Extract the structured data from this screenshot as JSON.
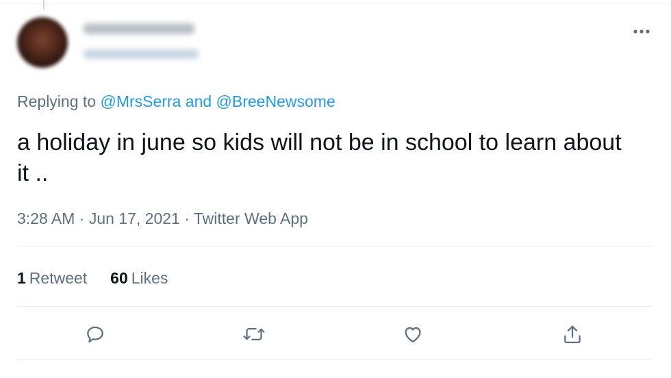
{
  "tweet": {
    "replying_prefix": "Replying to",
    "mentions": [
      "@MrsSerra",
      "@BreeNewsome"
    ],
    "mention_joiner": "and",
    "text": "a holiday in june so kids will not be in school to learn about it ..",
    "time": "3:28 AM",
    "date": "Jun 17, 2021",
    "source": "Twitter Web App",
    "separator": "·"
  },
  "stats": {
    "retweets_count": "1",
    "retweets_label": "Retweet",
    "likes_count": "60",
    "likes_label": "Likes"
  },
  "icons": {
    "more": "more-horizontal-icon",
    "reply": "reply-icon",
    "retweet": "retweet-icon",
    "like": "heart-icon",
    "share": "share-icon"
  },
  "colors": {
    "mention": "#1d9bf0",
    "secondary_text": "#5b7083",
    "primary_text": "#0f1419",
    "divider": "#e6ecf0"
  }
}
